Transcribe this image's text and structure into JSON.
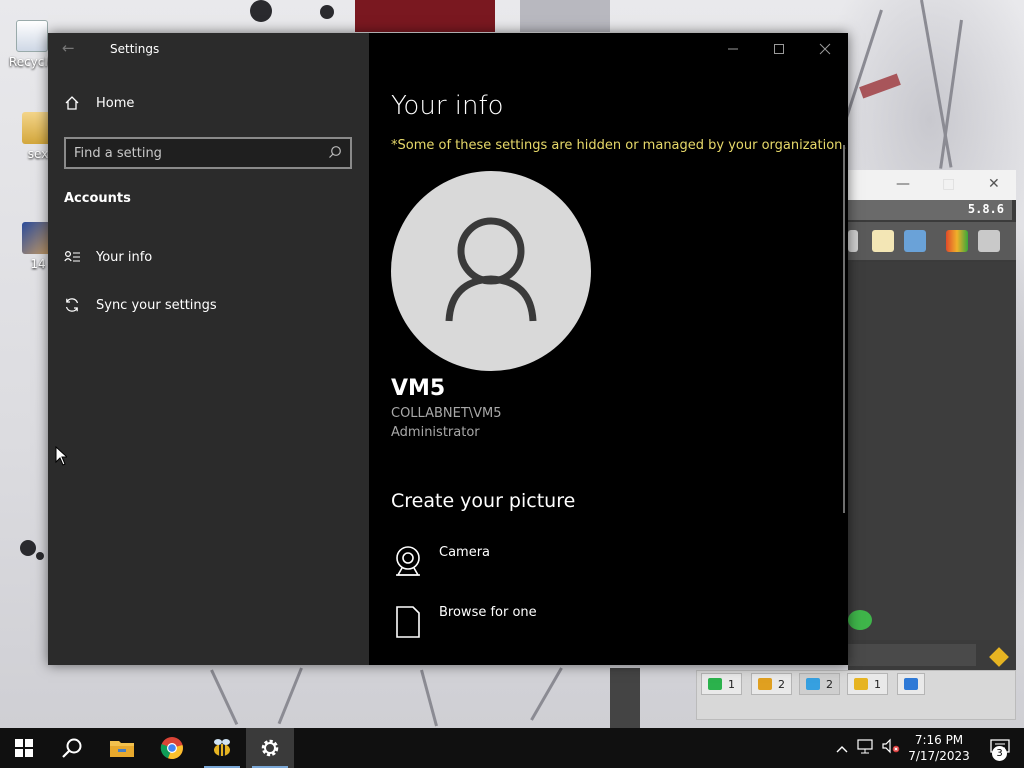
{
  "desktop": {
    "icons": [
      {
        "label": "Recycle",
        "icon": "recycle-bin-icon"
      },
      {
        "label": "sex",
        "icon": "folder-icon"
      },
      {
        "label": "14",
        "icon": "video-file-icon"
      }
    ]
  },
  "background_app": {
    "version": "5.8.6",
    "tabs": [
      {
        "count": "1",
        "icon": "monitor-icon",
        "color": "#2bb24c"
      },
      {
        "count": "2",
        "icon": "users-icon",
        "color": "#e0a020"
      },
      {
        "count": "2",
        "icon": "chat-icon",
        "color": "#36a0e0"
      },
      {
        "count": "1",
        "icon": "group-icon",
        "color": "#e6b422"
      },
      {
        "count": "",
        "icon": "transfer-icon",
        "color": "#2e79d6"
      }
    ]
  },
  "settings": {
    "window_title": "Settings",
    "sidebar": {
      "home_label": "Home",
      "search_placeholder": "Find a setting",
      "section_header": "Accounts",
      "items": [
        {
          "label": "Your info",
          "icon": "person-card-icon"
        },
        {
          "label": "Sync your settings",
          "icon": "sync-icon"
        }
      ]
    },
    "main": {
      "title": "Your info",
      "org_notice": "*Some of these settings are hidden or managed by your organization.",
      "user_name": "VM5",
      "account": "COLLABNET\\VM5",
      "role": "Administrator",
      "create_picture_header": "Create your picture",
      "picture_options": [
        {
          "label": "Camera",
          "icon": "camera-icon"
        },
        {
          "label": "Browse for one",
          "icon": "document-icon"
        }
      ]
    },
    "colors": {
      "sidebar_bg": "#2b2b2b",
      "main_bg": "#000000",
      "notice": "#e7d96a"
    }
  },
  "taskbar": {
    "apps": [
      "start-icon",
      "search-icon",
      "file-explorer-icon",
      "chrome-icon",
      "bee-app-icon",
      "settings-gear-icon"
    ],
    "time": "7:16 PM",
    "date": "7/17/2023",
    "notification_count": "3"
  }
}
